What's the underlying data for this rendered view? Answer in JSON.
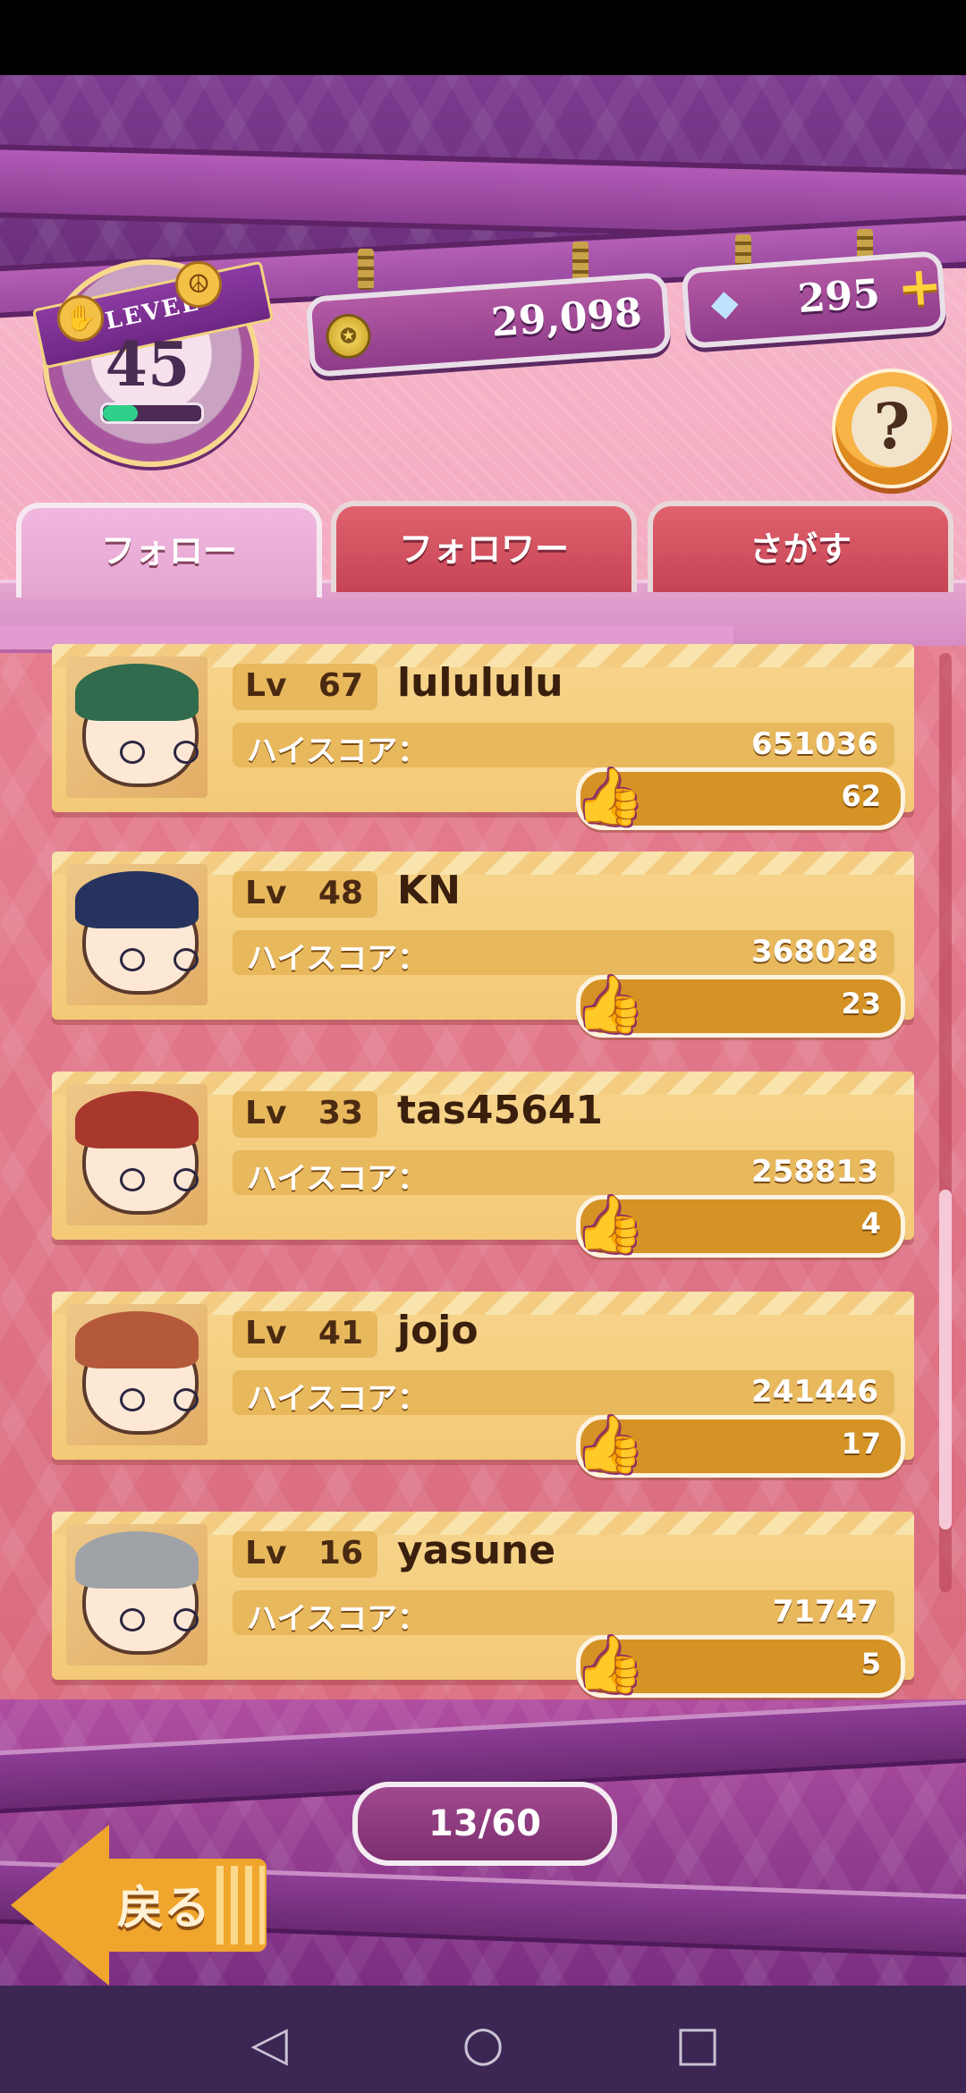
{
  "header": {
    "level_label": "LEVEL",
    "level": "45",
    "level_progress": 0.35,
    "coins": "29,098",
    "gems": "295",
    "help_symbol": "?"
  },
  "tabs": [
    {
      "label": "フォロー",
      "active": true
    },
    {
      "label": "フォロワー",
      "active": false
    },
    {
      "label": "さがす",
      "active": false
    }
  ],
  "list": {
    "level_prefix": "Lv",
    "score_label": "ハイスコア：",
    "players": [
      {
        "level": "67",
        "name": "lulululu",
        "score": "651036",
        "likes": "62",
        "hair_color": "#2f6b4c"
      },
      {
        "level": "48",
        "name": "KN",
        "score": "368028",
        "likes": "23",
        "hair_color": "#27335e"
      },
      {
        "level": "33",
        "name": "tas45641",
        "score": "258813",
        "likes": "4",
        "hair_color": "#a8382c"
      },
      {
        "level": "41",
        "name": "jojo",
        "score": "241446",
        "likes": "17",
        "hair_color": "#b4593a"
      },
      {
        "level": "16",
        "name": "yasune",
        "score": "71747",
        "likes": "5",
        "hair_color": "#9fa3a8"
      }
    ]
  },
  "pagination": {
    "text": "13/60"
  },
  "back_button": {
    "label": "戻る"
  },
  "icons": {
    "coin": "coin-icon",
    "gem": "gem-icon",
    "plus": "plus-icon",
    "thumb": "thumbs-up-icon",
    "back": "back-arrow-icon"
  },
  "colors": {
    "accent_purple": "#7b3a8e",
    "card_gold": "#f3c977",
    "like_bar": "#d49324",
    "tab_inactive": "#c64455"
  }
}
